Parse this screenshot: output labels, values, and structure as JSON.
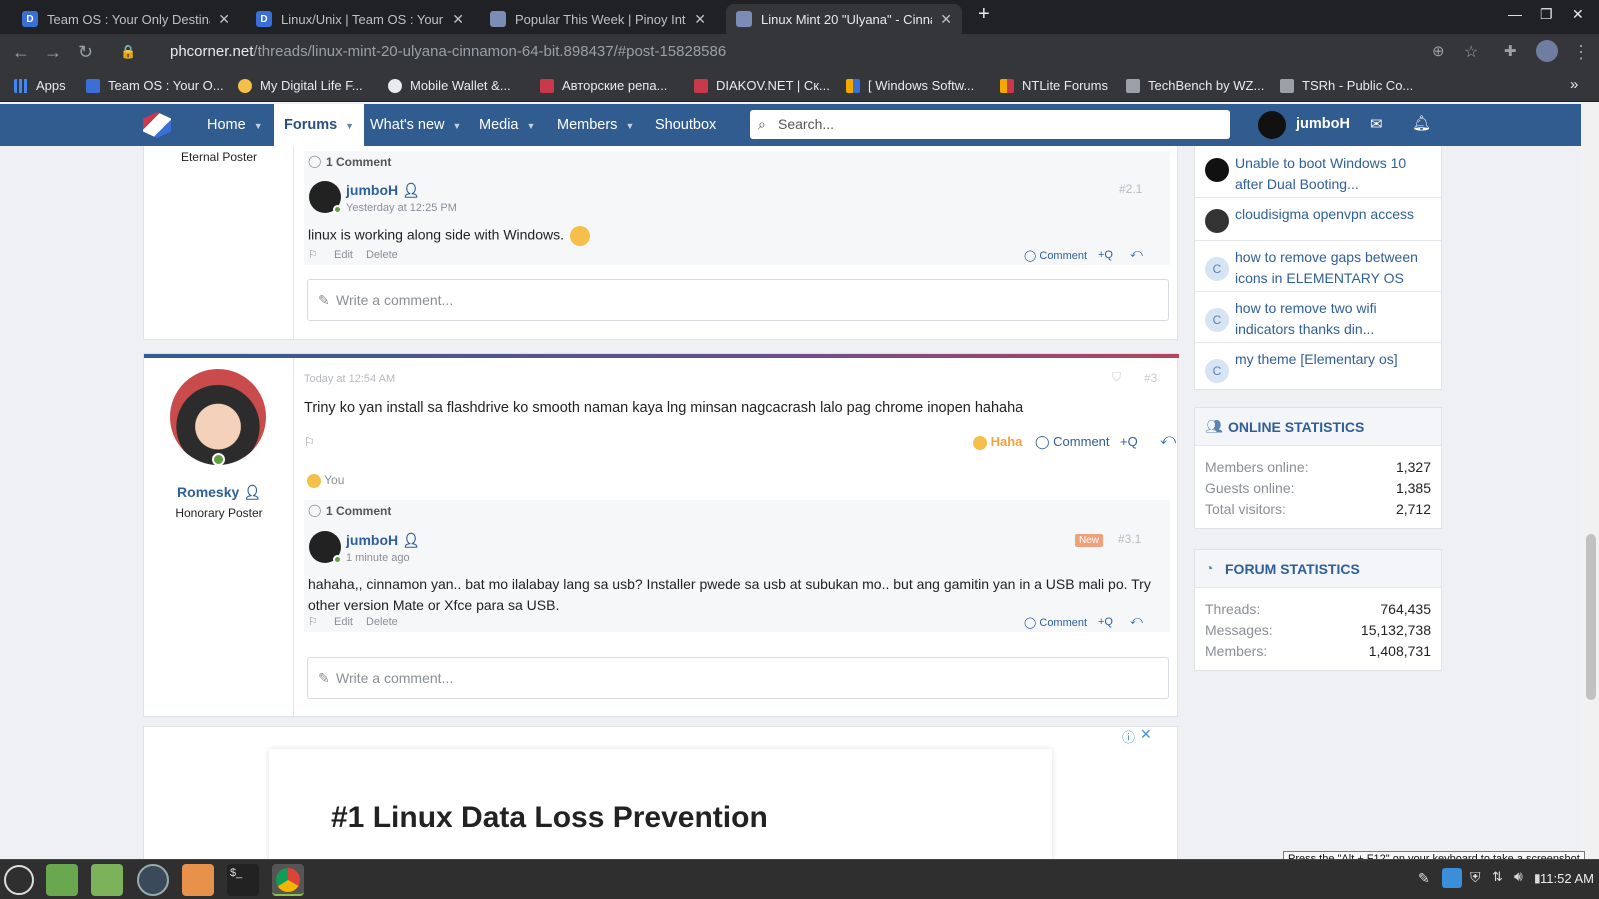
{
  "browser": {
    "tabs": [
      {
        "title": "Team OS : Your Only Destinati",
        "icon_color": "#3b6fd8",
        "icon": "D"
      },
      {
        "title": "Linux/Unix | Team OS : Your O",
        "icon_color": "#3b6fd8",
        "icon": "D"
      },
      {
        "title": "Popular This Week | Pinoy Inte",
        "icon_color": "#7c8db5",
        "icon": ""
      },
      {
        "title": "Linux Mint 20 \"Ulyana\" - Cinna",
        "icon_color": "#7c8db5",
        "icon": ""
      }
    ],
    "new_tab": "+",
    "url_host": "phcorner.net",
    "url_path": "/threads/linux-mint-20-ulyana-cinnamon-64-bit.898437/#post-15828586",
    "bookmarks": [
      {
        "label": "Apps",
        "color": "#4285f4"
      },
      {
        "label": "Team OS : Your O...",
        "color": "#3b6fd8"
      },
      {
        "label": "My Digital Life F...",
        "color": "#f5c04a"
      },
      {
        "label": "Mobile Wallet &...",
        "color": "#e8eaed"
      },
      {
        "label": "Авторские репа...",
        "color": "#c7394b"
      },
      {
        "label": "DIAKOV.NET | Ск...",
        "color": "#c7394b"
      },
      {
        "label": "[ Windows Softw...",
        "color": "#f2a900"
      },
      {
        "label": "NTLite Forums",
        "color": "#f2a900"
      },
      {
        "label": "TechBench by WZ...",
        "color": "#9aa0a6"
      },
      {
        "label": "TSRh - Public Co...",
        "color": "#9aa0a6"
      }
    ],
    "more": "»"
  },
  "site_nav": {
    "items": [
      "Home",
      "Forums",
      "What's new",
      "Media",
      "Members",
      "Shoutbox"
    ],
    "search_placeholder": "Search...",
    "username": "jumboH"
  },
  "post_top": {
    "author_title": "Eternal Poster",
    "comments_count": "1 Comment",
    "comment": {
      "author": "jumboH",
      "time": "Yesterday at 12:25 PM",
      "number": "#2.1",
      "text": "linux is working along side with Windows.",
      "edit": "Edit",
      "delete": "Delete",
      "comment": "Comment",
      "quote": "+Q"
    },
    "write_placeholder": "Write a comment..."
  },
  "post_main": {
    "author": "Romesky",
    "author_title": "Honorary Poster",
    "time": "Today at 12:54 AM",
    "number": "#3",
    "text": "Triny ko yan install sa flashdrive ko smooth naman kaya lng minsan nagcacrash lalo pag chrome inopen hahaha",
    "reaction": "Haha",
    "comment": "Comment",
    "quote": "+Q",
    "reacted_by": "You",
    "comments_count": "1 Comment",
    "reply": {
      "author": "jumboH",
      "time": "1 minute ago",
      "badge": "New",
      "number": "#3.1",
      "text_line1": "hahaha,, cinnamon yan.. bat mo ilalabay lang sa usb? Installer pwede sa usb at subukan mo.. but ang gamitin yan in a USB mali po. Try",
      "text_line2": "other version Mate or Xfce para sa USB.",
      "edit": "Edit",
      "delete": "Delete",
      "comment": "Comment",
      "quote": "+Q"
    },
    "write_placeholder": "Write a comment..."
  },
  "ad": {
    "headline": "#1 Linux Data Loss Prevention"
  },
  "sidebar": {
    "threads": [
      {
        "title": "Unable to boot Windows 10 after Dual Booting...",
        "avatar": ""
      },
      {
        "title": "cloudisigma openvpn access",
        "avatar": ""
      },
      {
        "title": "how to remove gaps between icons in ELEMENTARY OS",
        "avatar": "C"
      },
      {
        "title": "how to remove two wifi indicators thanks din...",
        "avatar": "C"
      },
      {
        "title": "my theme [Elementary os]",
        "avatar": "C"
      }
    ],
    "online": {
      "heading": "ONLINE STATISTICS",
      "rows": [
        {
          "k": "Members online:",
          "v": "1,327"
        },
        {
          "k": "Guests online:",
          "v": "1,385"
        },
        {
          "k": "Total visitors:",
          "v": "2,712"
        }
      ]
    },
    "forum": {
      "heading": "FORUM STATISTICS",
      "rows": [
        {
          "k": "Threads:",
          "v": "764,435"
        },
        {
          "k": "Messages:",
          "v": "15,132,738"
        },
        {
          "k": "Members:",
          "v": "1,408,731"
        }
      ]
    }
  },
  "tooltip": "Press the \"Alt + F12\" on your keyboard to take a screenshot",
  "taskbar": {
    "clock": "11:52 AM"
  }
}
